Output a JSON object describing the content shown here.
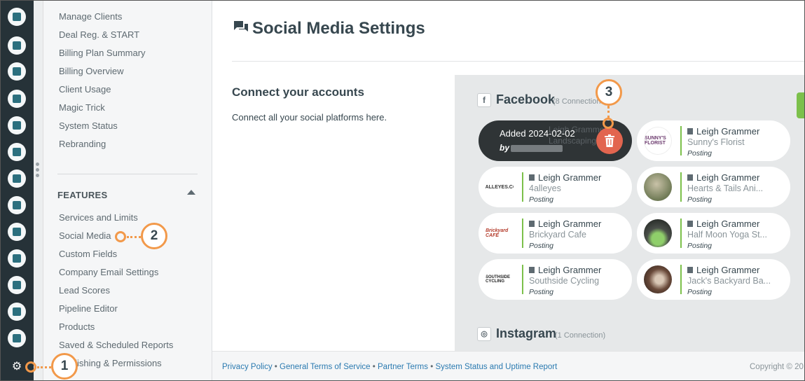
{
  "settings_menu": {
    "top_items": [
      "Manage Clients",
      "Deal Reg. & START",
      "Billing Plan Summary",
      "Billing Overview",
      "Client Usage",
      "Magic Trick",
      "System Status",
      "Rebranding"
    ],
    "features_heading": "FEATURES",
    "feature_items": [
      "Services and Limits",
      "Social Media",
      "Custom Fields",
      "Company Email Settings",
      "Lead Scores",
      "Pipeline Editor",
      "Products",
      "Saved & Scheduled Reports",
      "Publishing & Permissions"
    ]
  },
  "main": {
    "title": "Social Media Settings",
    "connect_heading": "Connect your accounts",
    "connect_text": "Connect all your social platforms here."
  },
  "facebook": {
    "title": "Facebook",
    "count": "(8 Connections)",
    "tooltip": {
      "added": "Added 2024-02-02",
      "by": "by",
      "ghost_user": "Leigh Grammer",
      "ghost_page": "Landscaping"
    },
    "cards": [
      {
        "user": "Leigh Grammer",
        "page": "Sunny's Florist",
        "status": "Posting",
        "logo": "SUNNY'S FLORIST"
      },
      {
        "user": "Leigh Grammer",
        "page": "4alleyes",
        "status": "Posting",
        "logo": "4ALLEYES.CO"
      },
      {
        "user": "Leigh Grammer",
        "page": "Hearts & Tails Ani...",
        "status": "Posting",
        "logo": ""
      },
      {
        "user": "Leigh Grammer",
        "page": "Brickyard Cafe",
        "status": "Posting",
        "logo": "Brickyard CAFE"
      },
      {
        "user": "Leigh Grammer",
        "page": "Half Moon Yoga St...",
        "status": "Posting",
        "logo": ""
      },
      {
        "user": "Leigh Grammer",
        "page": "Southside Cycling",
        "status": "Posting",
        "logo": "SOUTHSIDE CYCLING"
      },
      {
        "user": "Leigh Grammer",
        "page": "Jack's Backyard Ba...",
        "status": "Posting",
        "logo": ""
      }
    ]
  },
  "instagram": {
    "title": "Instagram",
    "count": "(1 Connection)"
  },
  "footer": {
    "privacy": "Privacy Policy",
    "terms": "General Terms of Service",
    "partner": "Partner Terms",
    "status": "System Status and Uptime Report",
    "sep": "•",
    "copyright": "Copyright © 20"
  },
  "callouts": {
    "one": "1",
    "two": "2",
    "three": "3"
  },
  "colors": {
    "accent": "#f2994a",
    "rail": "#263238",
    "green": "#7cc04b",
    "delete": "#e2654f"
  }
}
